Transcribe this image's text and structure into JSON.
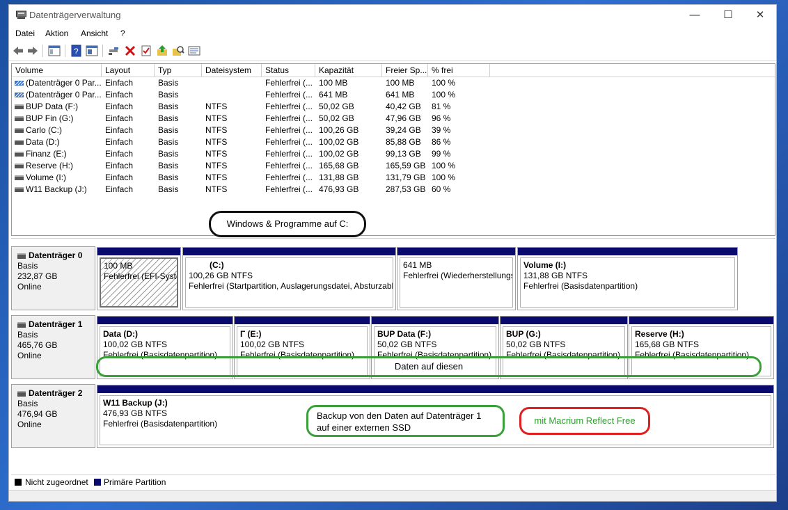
{
  "window": {
    "title": "Datenträgerverwaltung"
  },
  "menu": [
    "Datei",
    "Aktion",
    "Ansicht",
    "?"
  ],
  "columns": [
    "Volume",
    "Layout",
    "Typ",
    "Dateisystem",
    "Status",
    "Kapazität",
    "Freier Sp...",
    "% frei"
  ],
  "volumes": [
    {
      "name": "(Datenträger 0 Par...",
      "layout": "Einfach",
      "type": "Basis",
      "fs": "",
      "status": "Fehlerfrei (...",
      "cap": "100 MB",
      "free": "100 MB",
      "pct": "100 %"
    },
    {
      "name": "(Datenträger 0 Par...",
      "layout": "Einfach",
      "type": "Basis",
      "fs": "",
      "status": "Fehlerfrei (...",
      "cap": "641 MB",
      "free": "641 MB",
      "pct": "100 %"
    },
    {
      "name": "BUP Data (F:)",
      "layout": "Einfach",
      "type": "Basis",
      "fs": "NTFS",
      "status": "Fehlerfrei (...",
      "cap": "50,02 GB",
      "free": "40,42 GB",
      "pct": "81 %"
    },
    {
      "name": "BUP Fin (G:)",
      "layout": "Einfach",
      "type": "Basis",
      "fs": "NTFS",
      "status": "Fehlerfrei (...",
      "cap": "50,02 GB",
      "free": "47,96 GB",
      "pct": "96 %"
    },
    {
      "name": "Carlo (C:)",
      "layout": "Einfach",
      "type": "Basis",
      "fs": "NTFS",
      "status": "Fehlerfrei (...",
      "cap": "100,26 GB",
      "free": "39,24 GB",
      "pct": "39 %"
    },
    {
      "name": "Data (D:)",
      "layout": "Einfach",
      "type": "Basis",
      "fs": "NTFS",
      "status": "Fehlerfrei (...",
      "cap": "100,02 GB",
      "free": "85,88 GB",
      "pct": "86 %"
    },
    {
      "name": "Finanz (E:)",
      "layout": "Einfach",
      "type": "Basis",
      "fs": "NTFS",
      "status": "Fehlerfrei (...",
      "cap": "100,02 GB",
      "free": "99,13 GB",
      "pct": "99 %"
    },
    {
      "name": "Reserve (H:)",
      "layout": "Einfach",
      "type": "Basis",
      "fs": "NTFS",
      "status": "Fehlerfrei (...",
      "cap": "165,68 GB",
      "free": "165,59 GB",
      "pct": "100 %"
    },
    {
      "name": "Volume (I:)",
      "layout": "Einfach",
      "type": "Basis",
      "fs": "NTFS",
      "status": "Fehlerfrei (...",
      "cap": "131,88 GB",
      "free": "131,79 GB",
      "pct": "100 %"
    },
    {
      "name": "W11 Backup (J:)",
      "layout": "Einfach",
      "type": "Basis",
      "fs": "NTFS",
      "status": "Fehlerfrei (...",
      "cap": "476,93 GB",
      "free": "287,53 GB",
      "pct": "60 %"
    }
  ],
  "annotations": {
    "windows_c": "Windows & Programme auf C:",
    "daten": "Daten auf diesen",
    "backup_line1": "Backup von den Daten auf Datenträger 1",
    "backup_line2": "auf einer externen SSD",
    "macrium": "mit Macrium Reflect Free"
  },
  "disks": [
    {
      "name": "Datenträger 0",
      "type": "Basis",
      "size": "232,87 GB",
      "status": "Online",
      "partitions": [
        {
          "title": "",
          "size": "100 MB",
          "status": "Fehlerfrei (EFI-Systempartition)"
        },
        {
          "title": "(C:)",
          "size": "100,26 GB NTFS",
          "status": "Fehlerfrei (Startpartition, Auslagerungsdatei, Absturzabbild"
        },
        {
          "title": "",
          "size": "641 MB",
          "status": "Fehlerfrei (Wiederherstellungspartition)"
        },
        {
          "title": "Volume  (I:)",
          "size": "131,88 GB NTFS",
          "status": "Fehlerfrei (Basisdatenpartition)"
        }
      ]
    },
    {
      "name": "Datenträger 1",
      "type": "Basis",
      "size": "465,76 GB",
      "status": "Online",
      "partitions": [
        {
          "title": "Data  (D:)",
          "size": "100,02 GB NTFS",
          "status": "Fehlerfrei (Basisdatenpartition)"
        },
        {
          "title": "Γ          (E:)",
          "size": "100,02 GB NTFS",
          "status": "Fehlerfrei (Basisdatenpartition)"
        },
        {
          "title": "BUP Data  (F:)",
          "size": "50,02 GB NTFS",
          "status": "Fehlerfrei (Basisdatenpartition)"
        },
        {
          "title": "BUP        (G:)",
          "size": "50,02 GB NTFS",
          "status": "Fehlerfrei (Basisdatenpartition)"
        },
        {
          "title": "Reserve  (H:)",
          "size": "165,68 GB NTFS",
          "status": "Fehlerfrei (Basisdatenpartition)"
        }
      ]
    },
    {
      "name": "Datenträger 2",
      "type": "Basis",
      "size": "476,94 GB",
      "status": "Online",
      "partitions": [
        {
          "title": "W11 Backup  (J:)",
          "size": "476,93 GB NTFS",
          "status": "Fehlerfrei (Basisdatenpartition)"
        }
      ]
    }
  ],
  "legend": {
    "unallocated": "Nicht zugeordnet",
    "primary": "Primäre Partition"
  }
}
